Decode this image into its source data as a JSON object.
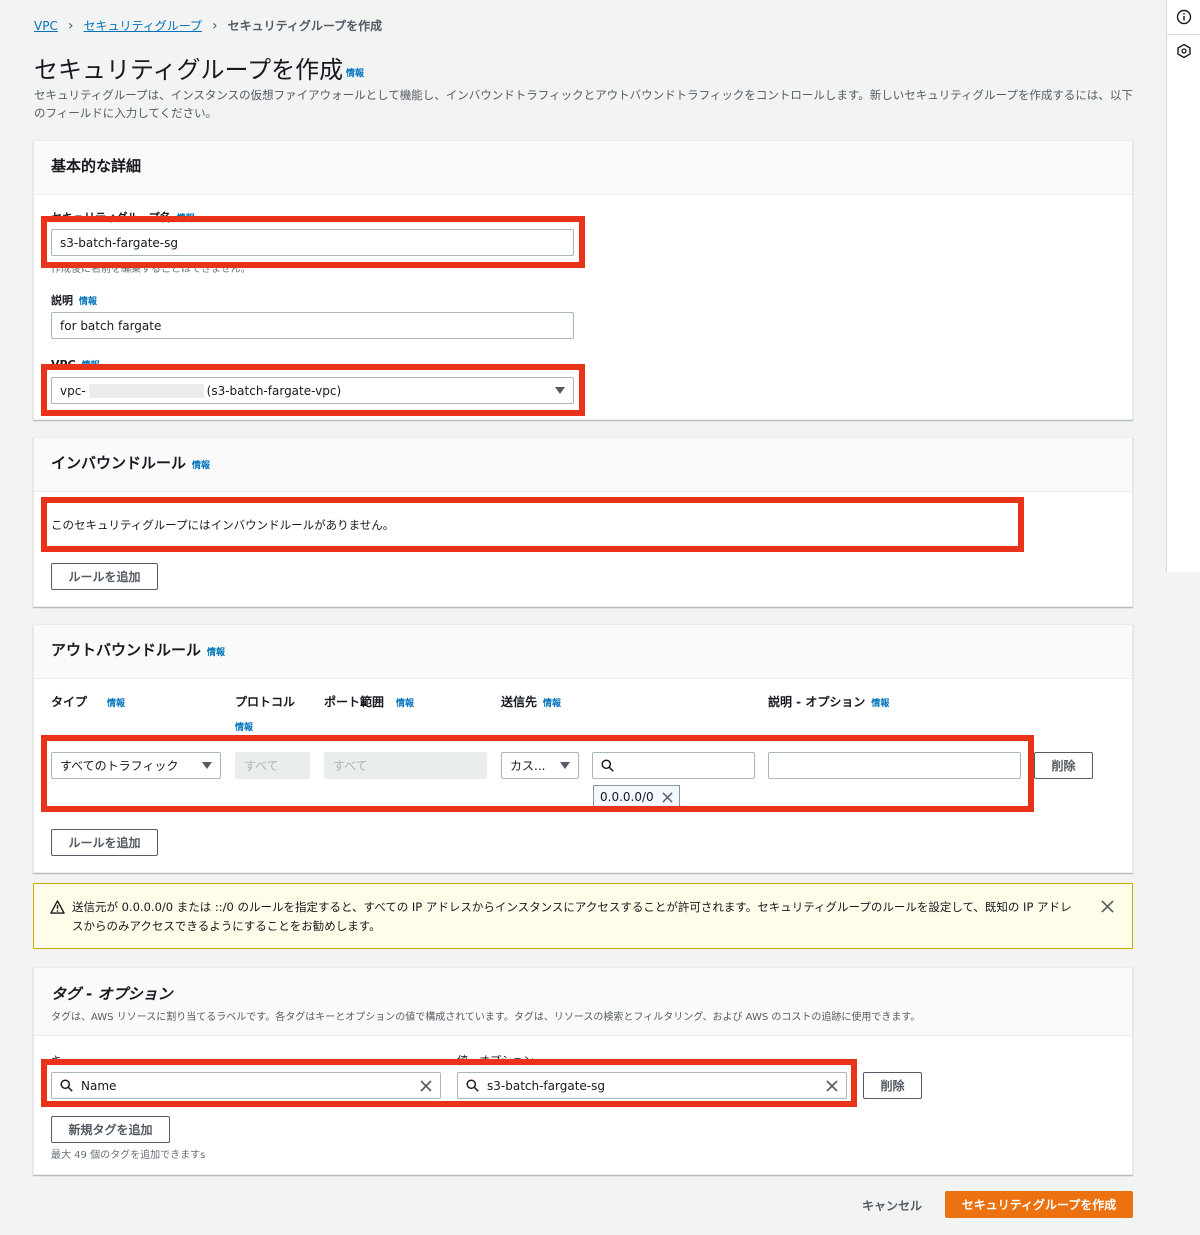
{
  "breadcrumb": {
    "vpc": "VPC",
    "security_groups": "セキュリティグループ",
    "current": "セキュリティグループを作成"
  },
  "info_label": "情報",
  "page": {
    "title": "セキュリティグループを作成",
    "description": "セキュリティグループは、インスタンスの仮想ファイアウォールとして機能し、インバウンドトラフィックとアウトバウンドトラフィックをコントロールします。新しいセキュリティグループを作成するには、以下のフィールドに入力してください。"
  },
  "basic": {
    "title": "基本的な詳細",
    "name_label": "セキュリティグループ名",
    "name_value": "s3-batch-fargate-sg",
    "name_hint": "作成後に名前を編集することはできません。",
    "desc_label": "説明",
    "desc_value": "for batch fargate",
    "vpc_label": "VPC",
    "vpc_prefix": "vpc-",
    "vpc_suffix": "(s3-batch-fargate-vpc)"
  },
  "inbound": {
    "title": "インバウンドルール",
    "empty": "このセキュリティグループにはインバウンドルールがありません。",
    "add_rule": "ルールを追加"
  },
  "outbound": {
    "title": "アウトバウンドルール",
    "col_type": "タイプ",
    "col_protocol": "プロトコル",
    "col_port": "ポート範囲",
    "col_dest": "送信先",
    "col_desc": "説明 - オプション",
    "type_value": "すべてのトラフィック",
    "protocol_value": "すべて",
    "port_value": "すべて",
    "dest_value": "カス...",
    "cidr_token": "0.0.0.0/0",
    "delete": "削除",
    "add_rule": "ルールを追加"
  },
  "warning": {
    "text": "送信元が 0.0.0.0/0 または ::/0 のルールを指定すると、すべての IP アドレスからインスタンスにアクセスすることが許可されます。セキュリティグループのルールを設定して、既知の IP アドレスからのみアクセスできるようにすることをお勧めします。"
  },
  "tags": {
    "title": "タグ - オプション",
    "description": "タグは、AWS リソースに割り当てるラベルです。各タグはキーとオプションの値で構成されています。タグは、リソースの検索とフィルタリング、および AWS のコストの追跡に使用できます。",
    "key_label": "キー",
    "value_label": "値 - オプション",
    "key_value": "Name",
    "value_value": "s3-batch-fargate-sg",
    "delete": "削除",
    "add_tag": "新規タグを追加",
    "limit_hint": "最大 49 個のタグを追加できますs"
  },
  "footer": {
    "cancel": "キャンセル",
    "create": "セキュリティグループを作成"
  },
  "colors": {
    "accent": "#0073bb",
    "primary": "#ec7211",
    "highlight": "#e8321a",
    "warning_bg": "#fffce9"
  }
}
